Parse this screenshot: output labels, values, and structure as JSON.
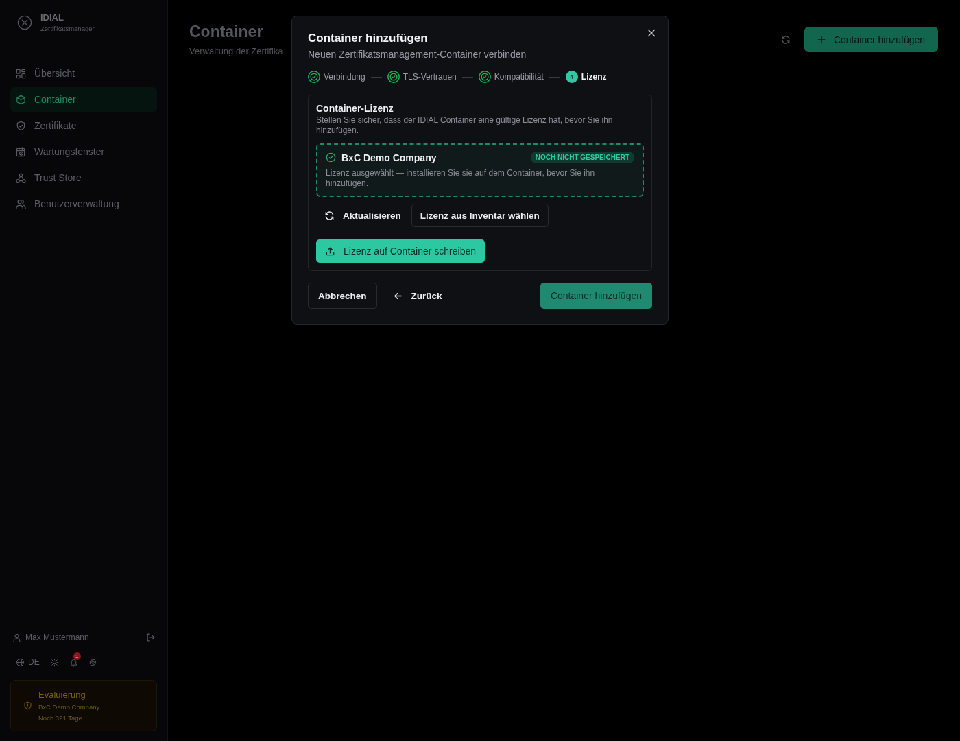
{
  "sidebar": {
    "brand": {
      "name": "IDIAL",
      "subtitle": "Zertifikatsmanager"
    },
    "nav": [
      {
        "label": "Übersicht",
        "selected": false
      },
      {
        "label": "Container",
        "selected": true
      },
      {
        "label": "Zertifikate",
        "selected": false
      },
      {
        "label": "Wartungsfenster",
        "selected": false
      },
      {
        "label": "Trust Store",
        "selected": false
      },
      {
        "label": "Benutzerverwaltung",
        "selected": false
      }
    ],
    "user": {
      "name": "Max Mustermann"
    },
    "language": "DE",
    "notifications": {
      "count": "1"
    },
    "license_card": {
      "title": "Evaluierung",
      "company": "BxC Demo Company",
      "remaining": "Noch 321 Tage"
    }
  },
  "page": {
    "title": "Container",
    "subtitle": "Verwaltung der Zertifika",
    "add_button": "Container hinzufügen"
  },
  "dialog": {
    "title": "Container hinzufügen",
    "subtitle": "Neuen Zertifikatsmanagement-Container verbinden",
    "steps": [
      {
        "label": "Verbindung",
        "completed": true
      },
      {
        "label": "TLS-Vertrauen",
        "completed": true
      },
      {
        "label": "Kompatibilität",
        "completed": true
      },
      {
        "label": "Lizenz",
        "number": "4",
        "completed": false
      }
    ],
    "section": {
      "title": "Container-Lizenz",
      "description": "Stellen Sie sicher, dass der IDIAL Container eine gültige Lizenz hat, bevor Sie ihn hinzufügen.",
      "license": {
        "name": "BxC Demo Company",
        "badge": "NOCH NICHT GESPEICHERT",
        "note": "Lizenz ausgewählt — installieren Sie sie auf dem Container, bevor Sie ihn hinzufügen."
      },
      "actions": [
        {
          "label": "Aktualisieren",
          "kind": "refresh"
        },
        {
          "label": "Lizenz aus Inventar wählen",
          "kind": "outline"
        },
        {
          "label": "Lizenz auf Container schreiben",
          "kind": "upload"
        }
      ]
    },
    "footer": {
      "cancel": "Abbrechen",
      "back": "Zurück",
      "submit": {
        "label": "Container hinzufügen",
        "disabled": true
      }
    }
  }
}
